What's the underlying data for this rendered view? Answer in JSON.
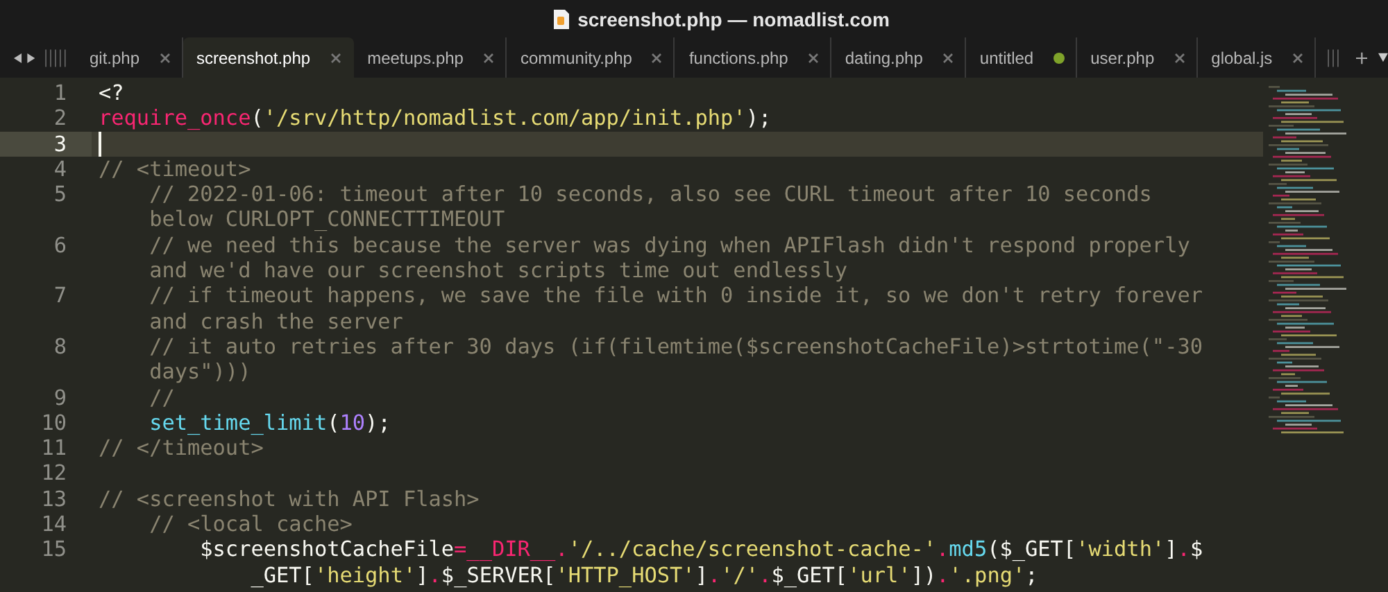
{
  "window": {
    "title": "screenshot.php — nomadlist.com"
  },
  "tabs": [
    {
      "label": "git.php",
      "selected": false,
      "modified": false
    },
    {
      "label": "screenshot.php",
      "selected": true,
      "modified": false
    },
    {
      "label": "meetups.php",
      "selected": false,
      "modified": false
    },
    {
      "label": "community.php",
      "selected": false,
      "modified": false
    },
    {
      "label": "functions.php",
      "selected": false,
      "modified": false
    },
    {
      "label": "dating.php",
      "selected": false,
      "modified": false
    },
    {
      "label": "untitled",
      "selected": false,
      "modified": true
    },
    {
      "label": "user.php",
      "selected": false,
      "modified": false
    },
    {
      "label": "global.js",
      "selected": false,
      "modified": false
    }
  ],
  "editor": {
    "lines": [
      {
        "number": "1",
        "selected": false,
        "rows": [
          {
            "tokens": [
              {
                "kind": "plain",
                "text": "<?"
              }
            ]
          }
        ]
      },
      {
        "number": "2",
        "selected": false,
        "rows": [
          {
            "tokens": [
              {
                "kind": "keyword",
                "text": "require_once"
              },
              {
                "kind": "plain",
                "text": "("
              },
              {
                "kind": "string",
                "text": "'/srv/http/nomadlist.com/app/init.php'"
              },
              {
                "kind": "plain",
                "text": ");"
              }
            ]
          }
        ]
      },
      {
        "number": "3",
        "selected": true,
        "rows": [
          {}
        ]
      },
      {
        "number": "4",
        "selected": false,
        "rows": [
          {
            "tokens": [
              {
                "kind": "comment",
                "text": "// <timeout>"
              }
            ]
          }
        ]
      },
      {
        "number": "5",
        "selected": false,
        "rows": [
          {
            "tokens": [
              {
                "kind": "comment",
                "text": "    // 2022-01-06: timeout after 10 seconds, also see CURL timeout after 10 seconds"
              }
            ]
          },
          {
            "tokens": [
              {
                "kind": "comment",
                "text": "    below CURLOPT_CONNECTTIMEOUT"
              }
            ]
          }
        ]
      },
      {
        "number": "6",
        "selected": false,
        "rows": [
          {
            "tokens": [
              {
                "kind": "comment",
                "text": "    // we need this because the server was dying when APIFlash didn't respond properly"
              }
            ]
          },
          {
            "tokens": [
              {
                "kind": "comment",
                "text": "    and we'd have our screenshot scripts time out endlessly"
              }
            ]
          }
        ]
      },
      {
        "number": "7",
        "selected": false,
        "rows": [
          {
            "tokens": [
              {
                "kind": "comment",
                "text": "    // if timeout happens, we save the file with 0 inside it, so we don't retry forever"
              }
            ]
          },
          {
            "tokens": [
              {
                "kind": "comment",
                "text": "    and crash the server"
              }
            ]
          }
        ]
      },
      {
        "number": "8",
        "selected": false,
        "rows": [
          {
            "tokens": [
              {
                "kind": "comment",
                "text": "    // it auto retries after 30 days (if(filemtime($screenshotCacheFile)>strtotime(\"-30"
              }
            ]
          },
          {
            "tokens": [
              {
                "kind": "comment",
                "text": "    days\")))"
              }
            ]
          }
        ]
      },
      {
        "number": "9",
        "selected": false,
        "rows": [
          {
            "tokens": [
              {
                "kind": "comment",
                "text": "    //"
              }
            ]
          }
        ]
      },
      {
        "number": "10",
        "selected": false,
        "rows": [
          {
            "tokens": [
              {
                "kind": "func",
                "text": "    set_time_limit"
              },
              {
                "kind": "plain",
                "text": "("
              },
              {
                "kind": "number",
                "text": "10"
              },
              {
                "kind": "plain",
                "text": ");"
              }
            ]
          }
        ]
      },
      {
        "number": "11",
        "selected": false,
        "rows": [
          {
            "tokens": [
              {
                "kind": "comment",
                "text": "// </timeout>"
              }
            ]
          }
        ]
      },
      {
        "number": "12",
        "selected": false,
        "rows": [
          {}
        ]
      },
      {
        "number": "13",
        "selected": false,
        "rows": [
          {
            "tokens": [
              {
                "kind": "comment",
                "text": "// <screenshot with API Flash>"
              }
            ]
          }
        ]
      },
      {
        "number": "14",
        "selected": false,
        "rows": [
          {
            "tokens": [
              {
                "kind": "comment",
                "text": "    // <local cache>"
              }
            ]
          }
        ]
      },
      {
        "number": "15",
        "selected": false,
        "rows": [
          {
            "tokens": [
              {
                "kind": "plain",
                "text": "        $screenshotCacheFile"
              },
              {
                "kind": "keyword",
                "text": "=__DIR__."
              },
              {
                "kind": "string",
                "text": "'/../cache/screenshot-cache-'"
              },
              {
                "kind": "keyword",
                "text": "."
              },
              {
                "kind": "func",
                "text": "md5"
              },
              {
                "kind": "plain",
                "text": "($_GET["
              },
              {
                "kind": "string",
                "text": "'width'"
              },
              {
                "kind": "plain",
                "text": "]"
              },
              {
                "kind": "keyword",
                "text": "."
              },
              {
                "kind": "plain",
                "text": "$"
              }
            ]
          },
          {
            "tokens": [
              {
                "kind": "plain",
                "text": "            _GET["
              },
              {
                "kind": "string",
                "text": "'height'"
              },
              {
                "kind": "plain",
                "text": "]"
              },
              {
                "kind": "keyword",
                "text": "."
              },
              {
                "kind": "plain",
                "text": "$_SERVER["
              },
              {
                "kind": "string",
                "text": "'HTTP_HOST'"
              },
              {
                "kind": "plain",
                "text": "]"
              },
              {
                "kind": "keyword",
                "text": "."
              },
              {
                "kind": "string",
                "text": "'/'"
              },
              {
                "kind": "keyword",
                "text": "."
              },
              {
                "kind": "plain",
                "text": "$_GET["
              },
              {
                "kind": "string",
                "text": "'url'"
              },
              {
                "kind": "plain",
                "text": "])"
              },
              {
                "kind": "keyword",
                "text": "."
              },
              {
                "kind": "string",
                "text": "'.png'"
              },
              {
                "kind": "plain",
                "text": ";"
              }
            ]
          }
        ]
      }
    ]
  }
}
